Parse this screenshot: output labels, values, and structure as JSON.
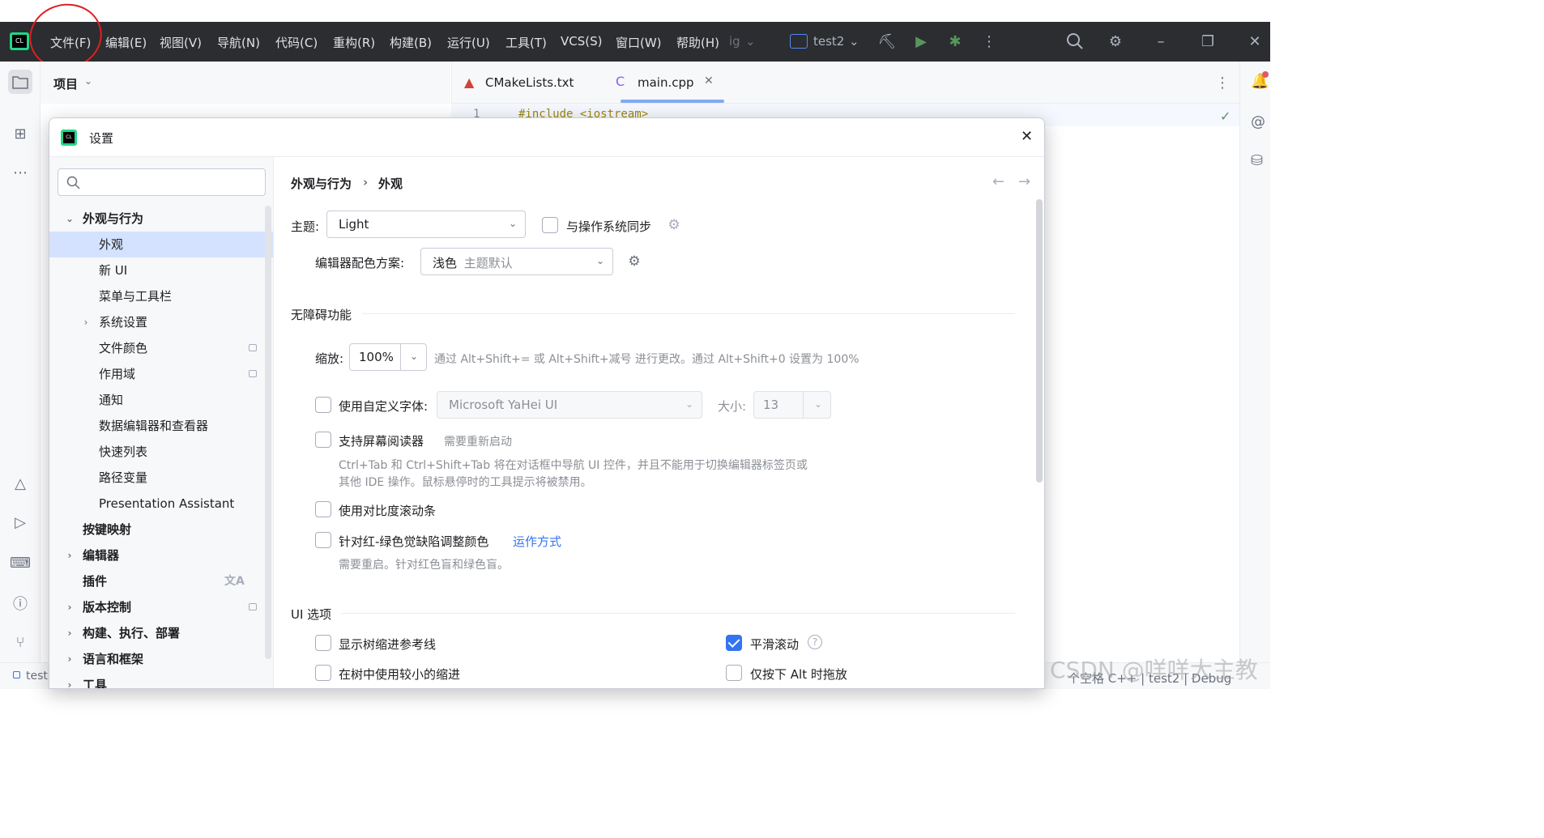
{
  "menubar": {
    "items": [
      "文件(F)",
      "编辑(E)",
      "视图(V)",
      "导航(N)",
      "代码(C)",
      "重构(R)",
      "构建(B)",
      "运行(U)",
      "工具(T)",
      "VCS(S)",
      "窗口(W)",
      "帮助(H)"
    ],
    "overflow": "ig",
    "project_selector": "test2"
  },
  "project_panel": {
    "title": "项目"
  },
  "editor": {
    "tabs": [
      {
        "label": "CMakeLists.txt",
        "active": false
      },
      {
        "label": "main.cpp",
        "active": true
      }
    ],
    "line_number": "1",
    "first_line": "#include <iostream>"
  },
  "statusbar": {
    "left": "test",
    "right": "个空格  C++ | test2 | Debug"
  },
  "dialog": {
    "title": "设置",
    "search_placeholder": "",
    "breadcrumb": [
      "外观与行为",
      "外观"
    ],
    "tree": [
      {
        "label": "外观与行为",
        "level": 0,
        "expanded": true,
        "bold": true
      },
      {
        "label": "外观",
        "level": 1,
        "selected": true
      },
      {
        "label": "新 UI",
        "level": 1
      },
      {
        "label": "菜单与工具栏",
        "level": 1
      },
      {
        "label": "系统设置",
        "level": 1,
        "collapsed": true
      },
      {
        "label": "文件颜色",
        "level": 1,
        "badge": true
      },
      {
        "label": "作用域",
        "level": 1,
        "badge": true
      },
      {
        "label": "通知",
        "level": 1
      },
      {
        "label": "数据编辑器和查看器",
        "level": 1
      },
      {
        "label": "快速列表",
        "level": 1
      },
      {
        "label": "路径变量",
        "level": 1
      },
      {
        "label": "Presentation Assistant",
        "level": 1
      },
      {
        "label": "按键映射",
        "level": 0,
        "bold": true
      },
      {
        "label": "编辑器",
        "level": 0,
        "bold": true,
        "collapsed": true
      },
      {
        "label": "插件",
        "level": 0,
        "bold": true,
        "translate": true
      },
      {
        "label": "版本控制",
        "level": 0,
        "bold": true,
        "collapsed": true,
        "badge": true
      },
      {
        "label": "构建、执行、部署",
        "level": 0,
        "bold": true,
        "collapsed": true
      },
      {
        "label": "语言和框架",
        "level": 0,
        "bold": true,
        "collapsed": true
      },
      {
        "label": "工具",
        "level": 0,
        "bold": true,
        "collapsed": true
      }
    ],
    "content": {
      "theme_label": "主题:",
      "theme_value": "Light",
      "sync_os_label": "与操作系统同步",
      "scheme_label": "编辑器配色方案:",
      "scheme_value": "浅色",
      "scheme_hint": "主题默认",
      "accessibility_title": "无障碍功能",
      "zoom_label": "缩放:",
      "zoom_value": "100%",
      "zoom_hint": "通过 Alt+Shift+= 或 Alt+Shift+减号 进行更改。通过 Alt+Shift+0 设置为 100%",
      "custom_font_label": "使用自定义字体:",
      "custom_font_value": "Microsoft YaHei UI",
      "size_label": "大小:",
      "size_value": "13",
      "screen_reader_label": "支持屏幕阅读器",
      "screen_reader_hint": "需要重新启动",
      "screen_reader_desc1": "Ctrl+Tab 和 Ctrl+Shift+Tab 将在对话框中导航 UI 控件，并且不能用于切换编辑器标签页或",
      "screen_reader_desc2": "其他 IDE 操作。鼠标悬停时的工具提示将被禁用。",
      "contrast_scrollbar_label": "使用对比度滚动条",
      "color_blind_label": "针对红-绿色觉缺陷调整颜色",
      "color_blind_link": "运作方式",
      "color_blind_hint": "需要重启。针对红色盲和绿色盲。",
      "ui_options_title": "UI 选项",
      "tree_guides_label": "显示树缩进参考线",
      "smooth_scroll_label": "平滑滚动",
      "smaller_indent_label": "在树中使用较小的缩进",
      "alt_drag_label": "仅按下 Alt 时拖放",
      "smooth_scroll_checked": true
    }
  },
  "watermark": "CSDN @咩咩大主教",
  "colors": {
    "titlebar_bg": "#2b2d30",
    "accent": "#3574f0",
    "selection": "#d4e2ff",
    "annotation_red": "#e02020"
  }
}
